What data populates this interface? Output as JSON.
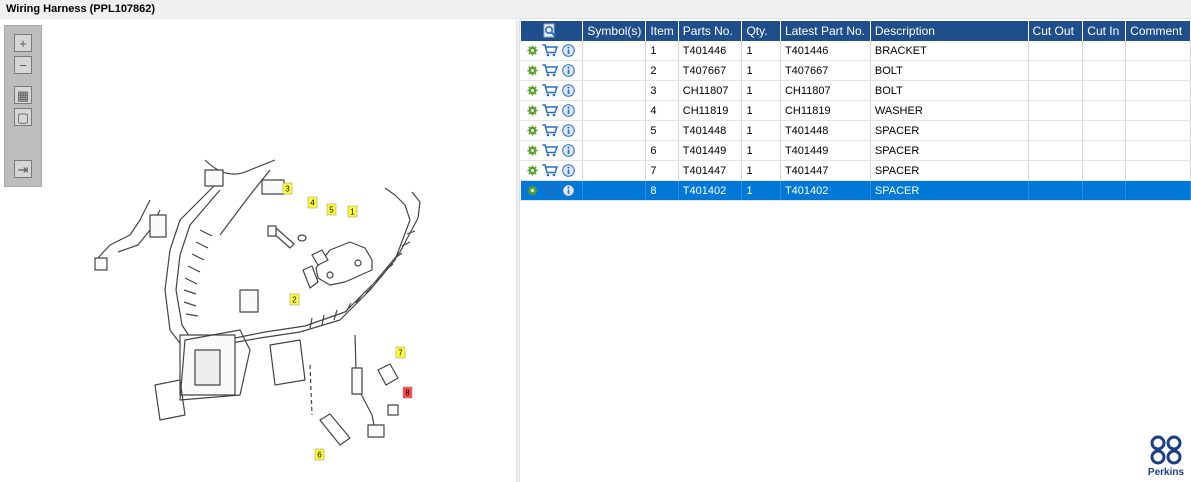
{
  "window": {
    "title": "Wiring Harness (PPL107862)"
  },
  "toolbox": {
    "tools": [
      {
        "name": "zoom-in",
        "glyph": "+"
      },
      {
        "name": "zoom-out",
        "glyph": "−"
      },
      {
        "name": "fit-all",
        "glyph": "▦"
      },
      {
        "name": "fit-window",
        "glyph": "▢"
      },
      {
        "name": "export",
        "glyph": "⇥"
      }
    ]
  },
  "diagram": {
    "callouts": [
      {
        "label": "1",
        "highlight": false
      },
      {
        "label": "2",
        "highlight": false
      },
      {
        "label": "3",
        "highlight": false
      },
      {
        "label": "4",
        "highlight": false
      },
      {
        "label": "5",
        "highlight": false
      },
      {
        "label": "6",
        "highlight": false
      },
      {
        "label": "7",
        "highlight": false
      },
      {
        "label": "8",
        "highlight": true
      }
    ],
    "colors": {
      "callout": "#ffff33",
      "callout_selected": "#ff4d4d"
    }
  },
  "table": {
    "headers": {
      "symbols": "Symbol(s)",
      "item": "Item",
      "parts_no": "Parts No.",
      "qty": "Qty.",
      "latest_part_no": "Latest Part No.",
      "description": "Description",
      "cut_out": "Cut Out",
      "cut_in": "Cut In",
      "comment": "Comment"
    },
    "rows": [
      {
        "item": "1",
        "parts_no": "T401446",
        "qty": "1",
        "latest_part_no": "T401446",
        "description": "BRACKET",
        "cut_out": "",
        "cut_in": "",
        "comment": "",
        "selected": false
      },
      {
        "item": "2",
        "parts_no": "T407667",
        "qty": "1",
        "latest_part_no": "T407667",
        "description": "BOLT",
        "cut_out": "",
        "cut_in": "",
        "comment": "",
        "selected": false
      },
      {
        "item": "3",
        "parts_no": "CH11807",
        "qty": "1",
        "latest_part_no": "CH11807",
        "description": "BOLT",
        "cut_out": "",
        "cut_in": "",
        "comment": "",
        "selected": false
      },
      {
        "item": "4",
        "parts_no": "CH11819",
        "qty": "1",
        "latest_part_no": "CH11819",
        "description": "WASHER",
        "cut_out": "",
        "cut_in": "",
        "comment": "",
        "selected": false
      },
      {
        "item": "5",
        "parts_no": "T401448",
        "qty": "1",
        "latest_part_no": "T401448",
        "description": "SPACER",
        "cut_out": "",
        "cut_in": "",
        "comment": "",
        "selected": false
      },
      {
        "item": "6",
        "parts_no": "T401449",
        "qty": "1",
        "latest_part_no": "T401449",
        "description": "SPACER",
        "cut_out": "",
        "cut_in": "",
        "comment": "",
        "selected": false
      },
      {
        "item": "7",
        "parts_no": "T401447",
        "qty": "1",
        "latest_part_no": "T401447",
        "description": "SPACER",
        "cut_out": "",
        "cut_in": "",
        "comment": "",
        "selected": false
      },
      {
        "item": "8",
        "parts_no": "T401402",
        "qty": "1",
        "latest_part_no": "T401402",
        "description": "SPACER",
        "cut_out": "",
        "cut_in": "",
        "comment": "",
        "selected": true
      }
    ],
    "row_icons": [
      "gear-icon",
      "cart-icon",
      "info-icon"
    ],
    "colors": {
      "header_bg": "#1f4e8c",
      "selected_bg": "#0078d7",
      "gear": "#5aa02c",
      "cart": "#2a6cc2",
      "info": "#2a6cc2"
    }
  },
  "brand": {
    "logo_text": "Perkins"
  }
}
